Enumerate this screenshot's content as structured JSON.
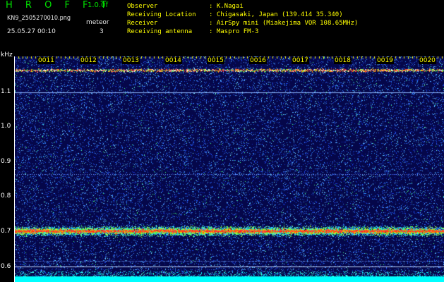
{
  "header": {
    "app_title": "H R O F F T",
    "version": "1.0.0f",
    "file_name": "KN9_2505270010.png",
    "meteor_label": "meteor",
    "timestamp": "25.05.27 00:10",
    "meteor_count": "3"
  },
  "info": {
    "labels": [
      "Observer",
      "Receiving Location",
      "Receiver",
      "Receiving antenna"
    ],
    "values": [
      ": K.Nagai",
      ": Chigasaki, Japan (139.414 35.340)",
      ": AirSpy mini (Miakejima VOR 108.65MHz)",
      ": Maspro FM-3"
    ]
  },
  "axis": {
    "y_unit": "kHz",
    "y_ticks": [
      "1.1",
      "1.0",
      "0.9",
      "0.8",
      "0.7",
      "0.6"
    ],
    "x_ticks": [
      "0011",
      "0012",
      "0013",
      "0014",
      "0015",
      "0016",
      "0017",
      "0018",
      "0019",
      "0020"
    ]
  },
  "colors": {
    "background": "#05074a",
    "signal_core": "#ff3030",
    "signal_mid": "#20ff40",
    "noise": "#2060ff",
    "bottom_band": "#00ffff"
  }
}
